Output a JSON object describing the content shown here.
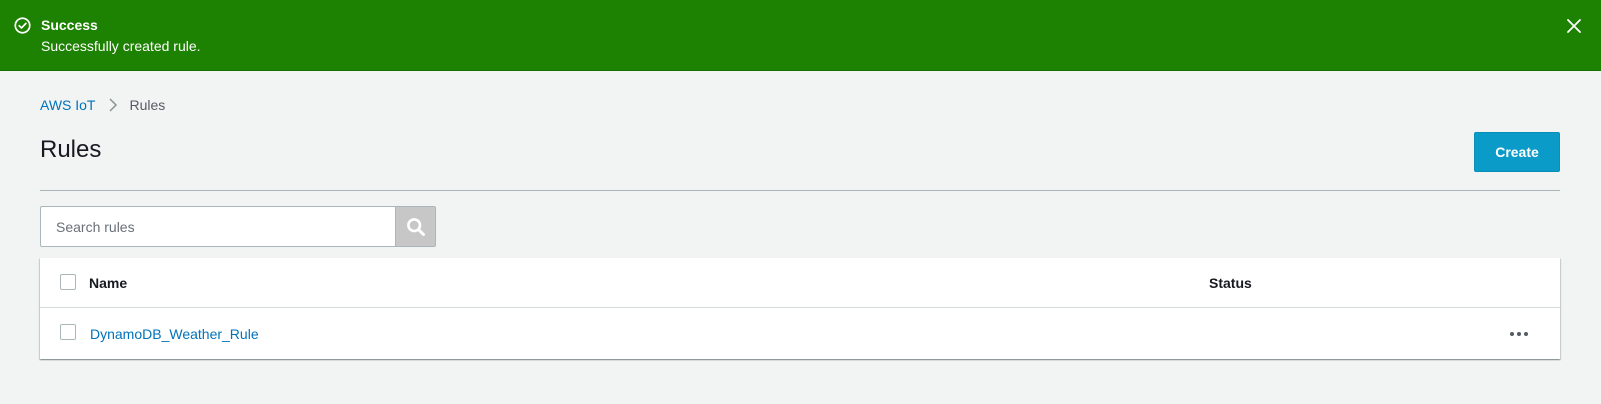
{
  "flash": {
    "title": "Success",
    "message": "Successfully created rule.",
    "icon": "check-circle-icon",
    "close_icon": "close-icon",
    "color": "#1d8102"
  },
  "breadcrumb": {
    "items": [
      {
        "label": "AWS IoT"
      },
      {
        "label": "Rules"
      }
    ]
  },
  "page": {
    "title": "Rules",
    "create_label": "Create"
  },
  "search": {
    "placeholder": "Search rules",
    "value": ""
  },
  "table": {
    "columns": [
      "Name",
      "Status"
    ],
    "rows": [
      {
        "name": "DynamoDB_Weather_Rule",
        "status": ""
      }
    ]
  },
  "colors": {
    "accent": "#0b9bc8",
    "link": "#0073bb",
    "success": "#1d8102"
  }
}
